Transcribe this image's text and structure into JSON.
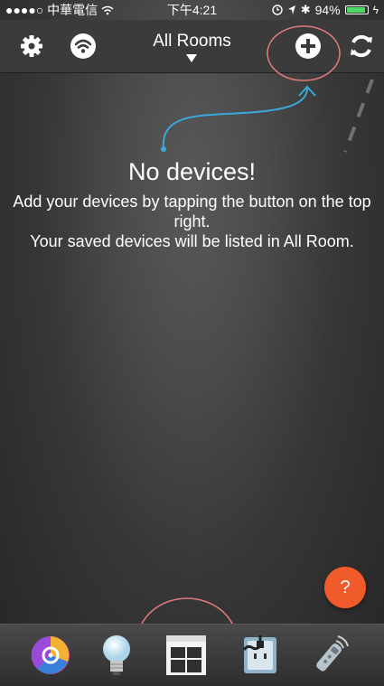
{
  "status_bar": {
    "carrier": "●●●●○ 中華電信",
    "time": "下午4:21",
    "battery": "94%",
    "battery_level": 0.94
  },
  "nav": {
    "title": "All Rooms",
    "icons": [
      "gear-icon",
      "wifi-icon",
      "add-icon",
      "refresh-icon"
    ]
  },
  "empty_state": {
    "title": "No devices!",
    "line1": "Add your devices by tapping the button on the top right.",
    "line2": "Your saved devices will be listed in All Room."
  },
  "help": {
    "label": "?"
  },
  "tabs": [
    {
      "icon": "color-wheel-icon"
    },
    {
      "icon": "light-bulb-icon"
    },
    {
      "icon": "curtain-icon"
    },
    {
      "icon": "power-outlet-icon"
    },
    {
      "icon": "remote-control-icon"
    }
  ],
  "colors": {
    "accent_line": "#3aa9d9",
    "highlight_circle": "#e07a7a",
    "help_button": "#f15a2a",
    "battery": "#4cd964"
  }
}
